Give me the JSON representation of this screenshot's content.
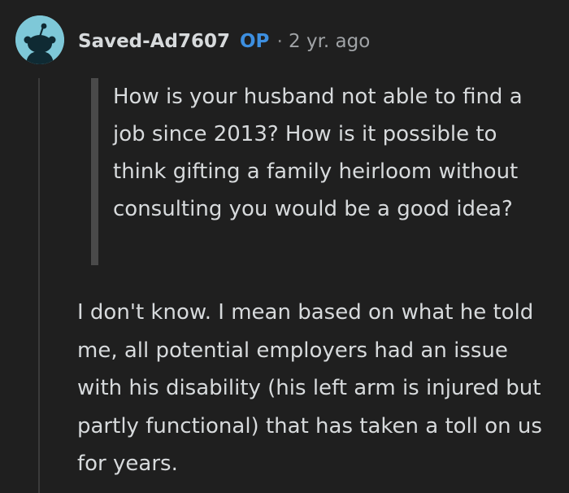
{
  "comment": {
    "author": "Saved-Ad7607",
    "op_badge": "OP",
    "separator": "·",
    "timestamp": "2 yr. ago",
    "avatar_icon": "snoo-avatar-icon",
    "quote": "How is your husband not able to find a job since 2013? How is it possible to think gifting a family heirloom without consulting you would be a good idea?",
    "body": "I don't know. I mean based on what he told me, all potential employers had an issue with his disability (his left arm is injured but partly functional) that has taken a toll on us for years."
  },
  "colors": {
    "background": "#1f1f1f",
    "text": "#d7dadc",
    "op_badge": "#3d8fe0",
    "avatar_bg": "#7ec8d8",
    "quote_bar": "#4a4a4a",
    "thread_line": "#3a3a3a"
  }
}
